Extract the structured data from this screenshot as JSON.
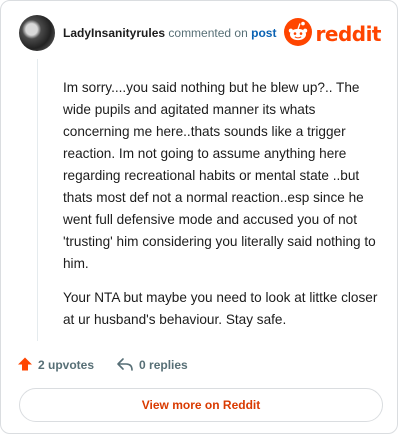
{
  "header": {
    "username": "LadyInsanityrules",
    "commented_text": "commented on",
    "post_link": "post",
    "brand_name": "reddit"
  },
  "comment": {
    "paragraphs": [
      "Im sorry....you said nothing but he blew up?.. The wide pupils and agitated manner its whats concerning me here..thats sounds like a trigger reaction. Im not going to assume anything here regarding recreational habits or mental state ..but thats most def not a normal reaction..esp since he went full defensive mode and accused you of not 'trusting' him considering you literally said nothing to him.",
      "Your NTA but maybe you need to look at littke closer at ur husband's behaviour. Stay safe."
    ]
  },
  "actions": {
    "upvotes_label": "2 upvotes",
    "replies_label": "0 replies"
  },
  "footer": {
    "view_more_label": "View more on Reddit"
  },
  "colors": {
    "brand": "#ff4500",
    "link": "#0a62b3",
    "cta": "#d93a00"
  },
  "icons": [
    "avatar",
    "reddit-logo-icon",
    "upvote-arrow-icon",
    "reply-icon"
  ]
}
